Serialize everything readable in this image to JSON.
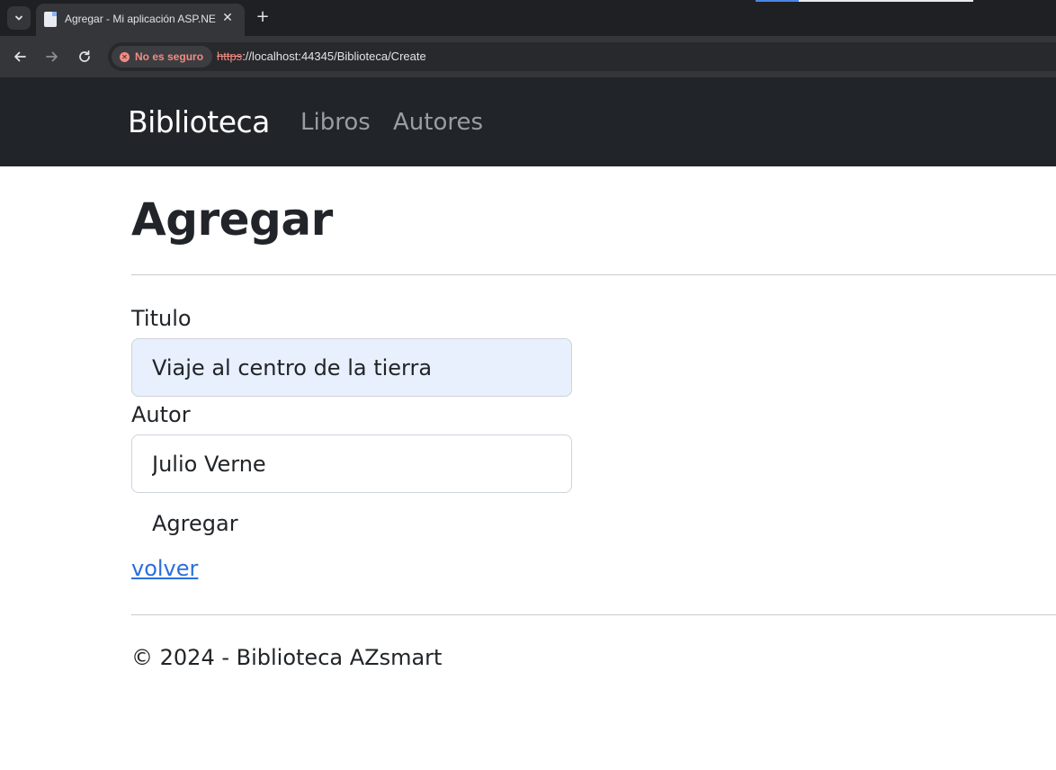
{
  "browser": {
    "tab": {
      "title": "Agregar - Mi aplicación ASP.NET Core"
    },
    "security_chip": {
      "label": "No es seguro"
    },
    "address": {
      "scheme": "https",
      "rest": "://localhost:44345/Biblioteca/Create"
    },
    "icons": {
      "tab_list": "chevron-down-icon",
      "favicon": "page-icon",
      "close": "close-icon",
      "new_tab": "plus-icon",
      "back": "arrow-left-icon",
      "forward": "arrow-right-icon",
      "reload": "reload-icon",
      "insecure": "warning-circle-icon"
    },
    "colors": {
      "insecure": "#f28b82",
      "chrome_bg": "#35363a"
    }
  },
  "navbar": {
    "brand": "Biblioteca",
    "links": [
      "Libros",
      "Autores"
    ],
    "colors": {
      "background": "#212529",
      "brand": "#ffffff",
      "link": "#9a9da0"
    }
  },
  "main": {
    "title": "Agregar",
    "fields": [
      {
        "label": "Titulo",
        "value": "Viaje al centro de la tierra"
      },
      {
        "label": "Autor",
        "value": "Julio Verne"
      }
    ],
    "submit_label": "Agregar",
    "back_link": "volver",
    "colors": {
      "link": "#2a6fdb",
      "autofill_bg": "#e8f0fe"
    }
  },
  "footer": {
    "text": "© 2024 - Biblioteca AZsmart"
  }
}
